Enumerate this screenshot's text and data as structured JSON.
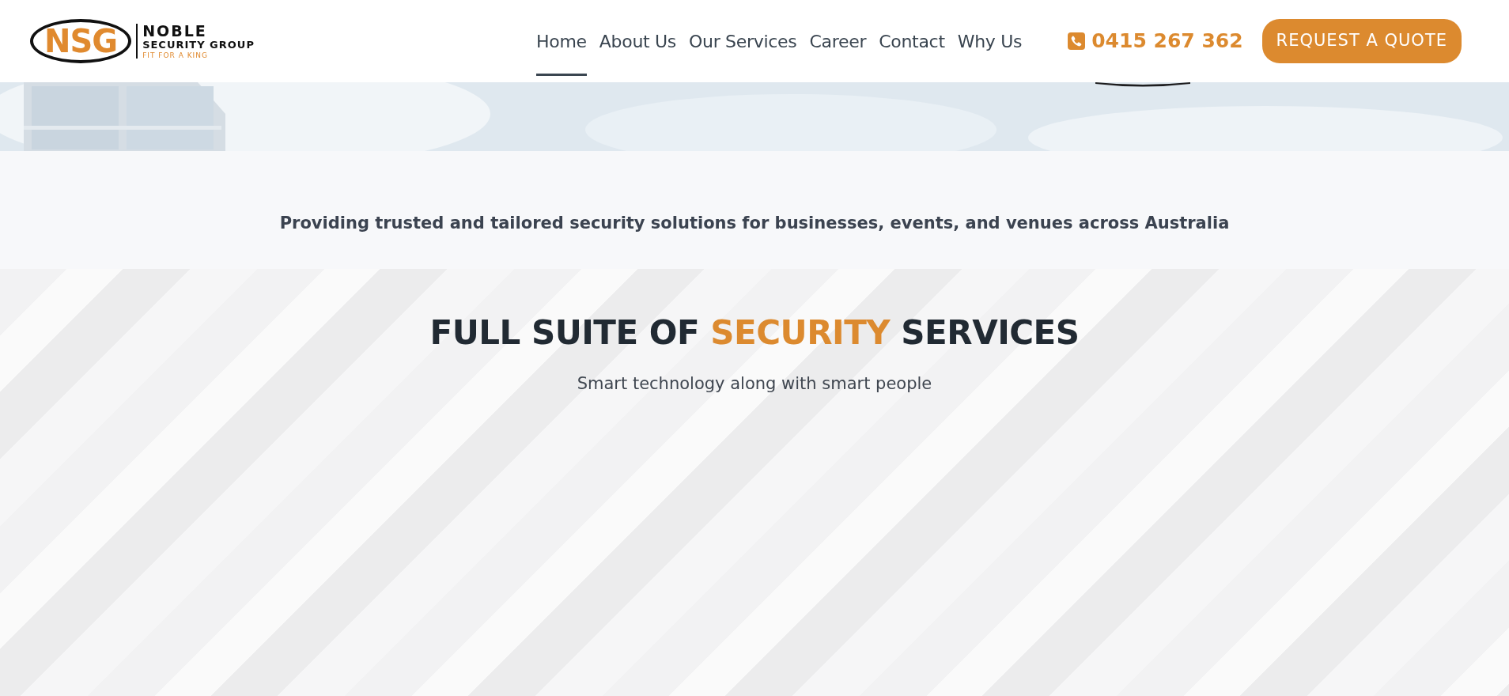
{
  "logo": {
    "monogram": "NSG",
    "name": "NOBLE",
    "subtitle": "SECURITY GROUP",
    "tagline": "FIT FOR A KING"
  },
  "nav": [
    {
      "label": "Home",
      "selected": true
    },
    {
      "label": "About Us",
      "selected": false
    },
    {
      "label": "Our Services",
      "selected": false
    },
    {
      "label": "Career",
      "selected": false
    },
    {
      "label": "Contact",
      "selected": false
    },
    {
      "label": "Why Us",
      "selected": false
    }
  ],
  "phone": "0415 267 362",
  "cta_button": "REQUEST A QUOTE",
  "intro": "Providing trusted and tailored security solutions for businesses, events, and venues across Australia",
  "services": {
    "heading_parts": [
      {
        "text": "FULL SUITE OF ",
        "accent": false
      },
      {
        "text": "SECURITY",
        "accent": true
      },
      {
        "text": " SERVICES",
        "accent": false
      }
    ],
    "subtitle": "Smart technology along with smart people"
  }
}
